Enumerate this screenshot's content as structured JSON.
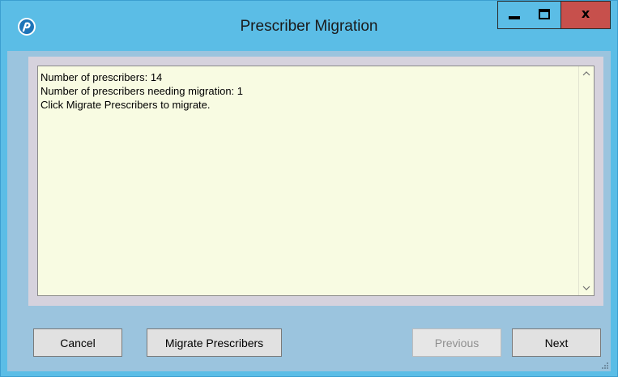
{
  "window": {
    "title": "Prescriber Migration",
    "controls": {
      "minimize_icon": "minimize-icon",
      "maximize_icon": "maximize-icon",
      "close_label": "x"
    },
    "app_icon": "app-logo-icon"
  },
  "log": {
    "lines": [
      "Number of prescribers: 14",
      "Number of prescribers needing migration: 1",
      "Click Migrate Prescribers to migrate."
    ],
    "scroll_up": "^",
    "scroll_down": "v"
  },
  "buttons": {
    "cancel": "Cancel",
    "migrate": "Migrate Prescribers",
    "previous": "Previous",
    "next": "Next"
  },
  "colors": {
    "titlebar": "#5bbde6",
    "client": "#9bc4de",
    "textbox_bg": "#f8fbe2",
    "close_button": "#c7504c"
  }
}
